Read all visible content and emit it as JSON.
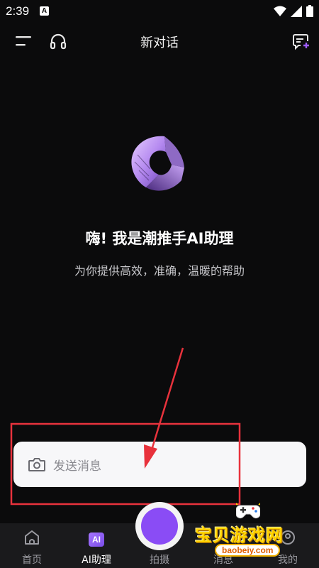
{
  "status_bar": {
    "time": "2:39",
    "a_badge": "A"
  },
  "header": {
    "title": "新对话"
  },
  "hero": {
    "greeting": "嗨! 我是潮推手AI助理",
    "subtitle": "为你提供高效，准确，温暖的帮助"
  },
  "input": {
    "placeholder": "发送消息"
  },
  "nav": {
    "home": "首页",
    "ai_badge": "AI",
    "ai_assistant": "AI助理",
    "shoot": "拍摄",
    "messages": "消息",
    "mine": "我的"
  },
  "watermark": {
    "brand": "宝贝游戏网",
    "url": "baobeiy.com"
  },
  "colors": {
    "background": "#0b0b0c",
    "accent": "#8a4cf5",
    "annotation": "#e8323c",
    "input_bg": "#f7f7f9",
    "nav_bg": "#1a1a1c"
  }
}
